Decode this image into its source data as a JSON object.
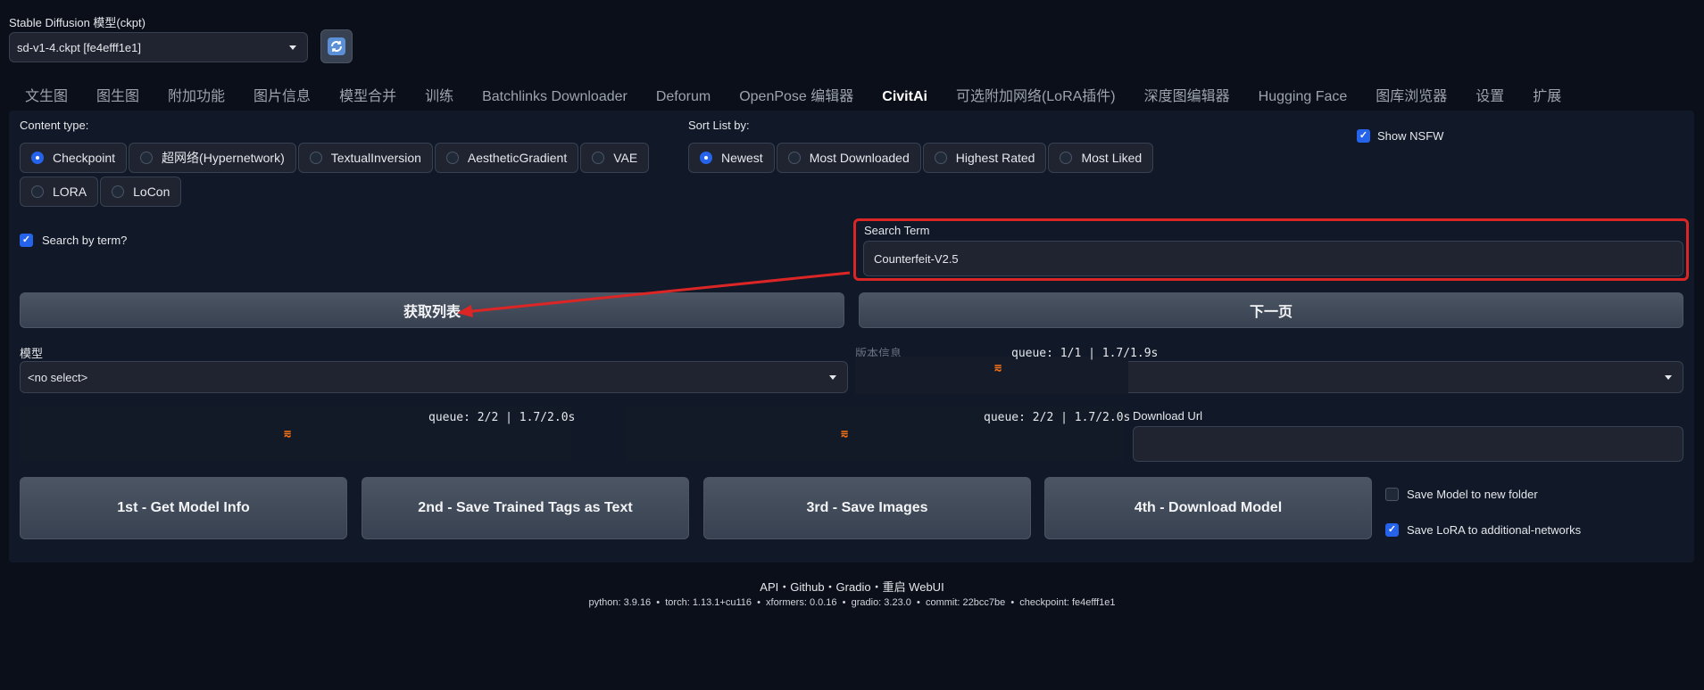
{
  "model_selector": {
    "label": "Stable Diffusion 模型(ckpt)",
    "value": "sd-v1-4.ckpt [fe4efff1e1]",
    "refresh_icon": "refresh-icon"
  },
  "tabs": [
    "文生图",
    "图生图",
    "附加功能",
    "图片信息",
    "模型合并",
    "训练",
    "Batchlinks Downloader",
    "Deforum",
    "OpenPose 编辑器",
    "CivitAi",
    "可选附加网络(LoRA插件)",
    "深度图编辑器",
    "Hugging Face",
    "图库浏览器",
    "设置",
    "扩展"
  ],
  "active_tab": "CivitAi",
  "content_type": {
    "label": "Content type:",
    "options": [
      "Checkpoint",
      "超网络(Hypernetwork)",
      "TextualInversion",
      "AestheticGradient",
      "VAE",
      "LORA",
      "LoCon"
    ],
    "selected": "Checkpoint"
  },
  "sort_list": {
    "label": "Sort List by:",
    "options": [
      "Newest",
      "Most Downloaded",
      "Highest Rated",
      "Most Liked"
    ],
    "selected": "Newest"
  },
  "show_nsfw": {
    "label": "Show NSFW",
    "checked": true
  },
  "search_by_term": {
    "label": "Search by term?",
    "checked": true
  },
  "search_term": {
    "label": "Search Term",
    "value": "Counterfeit-V2.5"
  },
  "buttons": {
    "get_list": "获取列表",
    "next_page": "下一页"
  },
  "model_dropdown": {
    "label": "模型",
    "value": "<no select>"
  },
  "version_info": {
    "label": "版本信息",
    "value": "null",
    "queue": "queue: 1/1 | 1.7/1.9s"
  },
  "output_left": {
    "queue": "queue: 2/2 | 1.7/2.0s"
  },
  "output_right": {
    "queue": "queue: 2/2 | 1.7/2.0s"
  },
  "download_url": {
    "label": "Download Url",
    "value": ""
  },
  "action_buttons": [
    "1st - Get Model Info",
    "2nd - Save Trained Tags as Text",
    "3rd - Save Images",
    "4th - Download Model"
  ],
  "save_options": [
    {
      "label": "Save Model to new folder",
      "checked": false
    },
    {
      "label": "Save LoRA to additional-networks",
      "checked": true
    }
  ],
  "footer": {
    "links": "API・Github・Gradio・重启 WebUI",
    "info": "python: 3.9.16  •  torch: 1.13.1+cu116  •  xformers: 0.0.16  •  gradio: 3.23.0  •  commit: 22bcc7be  •  checkpoint: fe4efff1e1"
  },
  "colors": {
    "accent": "#2563eb",
    "highlight_box": "#dc2626",
    "loader": "#f97316"
  }
}
